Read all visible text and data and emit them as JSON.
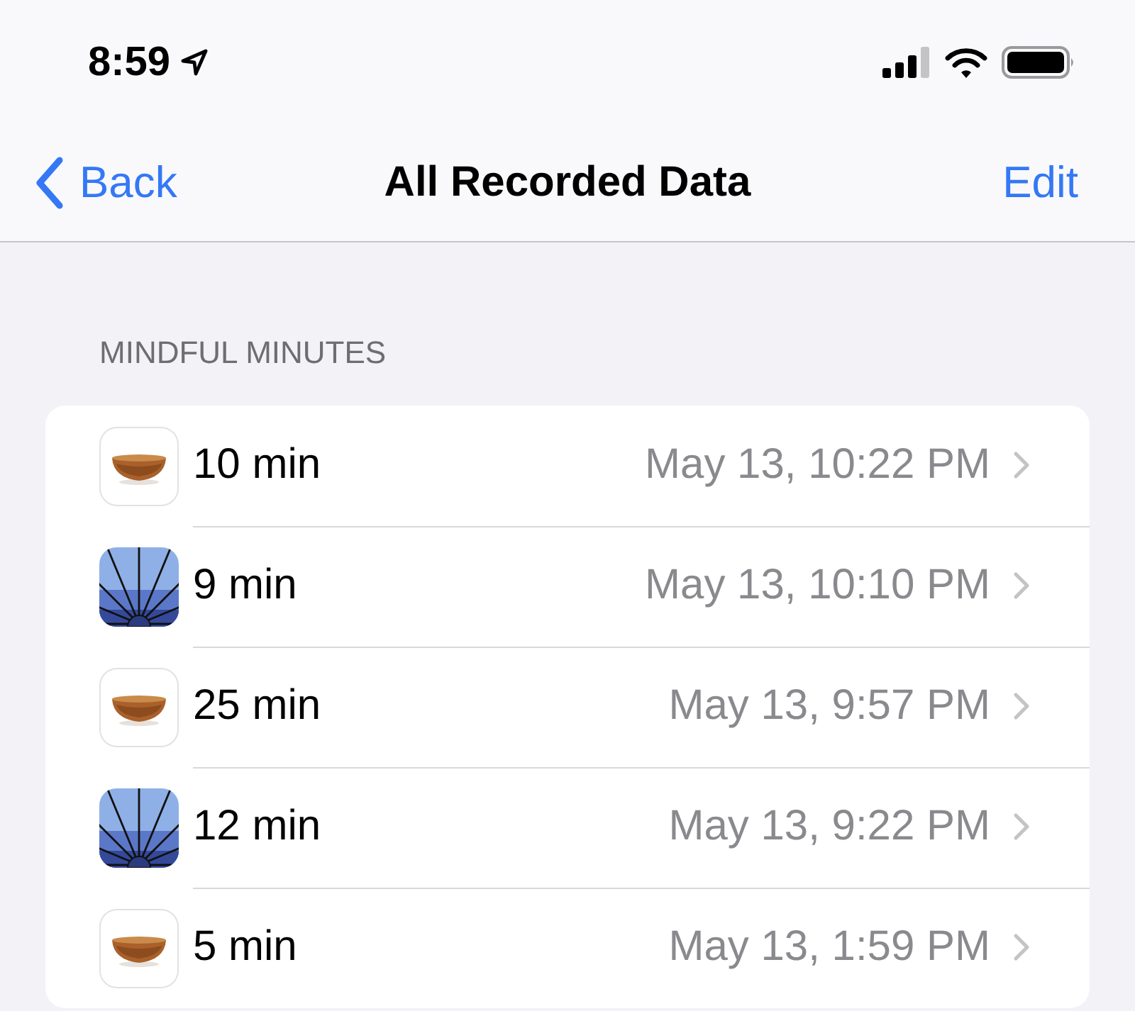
{
  "status_bar": {
    "time": "8:59"
  },
  "nav": {
    "back": "Back",
    "title": "All Recorded Data",
    "action": "Edit"
  },
  "section": {
    "header": "MINDFUL MINUTES",
    "rows": [
      {
        "kind": "bowl",
        "duration": "10 min",
        "date": "May 13, 10:22 PM"
      },
      {
        "kind": "rays",
        "duration": "9 min",
        "date": "May 13, 10:10 PM"
      },
      {
        "kind": "bowl",
        "duration": "25 min",
        "date": "May 13, 9:57 PM"
      },
      {
        "kind": "rays",
        "duration": "12 min",
        "date": "May 13, 9:22 PM"
      },
      {
        "kind": "bowl",
        "duration": "5 min",
        "date": "May 13, 1:59 PM"
      }
    ]
  }
}
